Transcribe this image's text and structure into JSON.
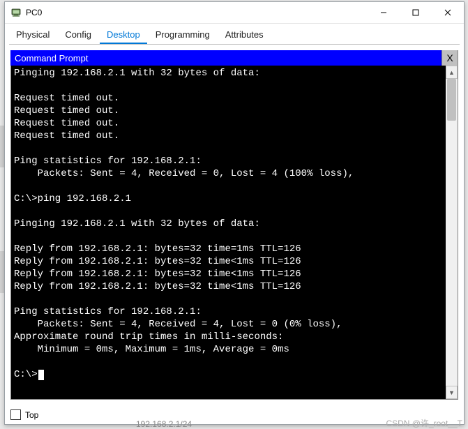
{
  "window": {
    "title": "PC0"
  },
  "tabs": [
    {
      "label": "Physical",
      "active": false
    },
    {
      "label": "Config",
      "active": false
    },
    {
      "label": "Desktop",
      "active": true
    },
    {
      "label": "Programming",
      "active": false
    },
    {
      "label": "Attributes",
      "active": false
    }
  ],
  "cmd": {
    "title": "Command Prompt",
    "close_label": "X"
  },
  "terminal_lines": [
    "Pinging 192.168.2.1 with 32 bytes of data:",
    "",
    "Request timed out.",
    "Request timed out.",
    "Request timed out.",
    "Request timed out.",
    "",
    "Ping statistics for 192.168.2.1:",
    "    Packets: Sent = 4, Received = 0, Lost = 4 (100% loss),",
    "",
    "C:\\>ping 192.168.2.1",
    "",
    "Pinging 192.168.2.1 with 32 bytes of data:",
    "",
    "Reply from 192.168.2.1: bytes=32 time=1ms TTL=126",
    "Reply from 192.168.2.1: bytes=32 time<1ms TTL=126",
    "Reply from 192.168.2.1: bytes=32 time<1ms TTL=126",
    "Reply from 192.168.2.1: bytes=32 time<1ms TTL=126",
    "",
    "Ping statistics for 192.168.2.1:",
    "    Packets: Sent = 4, Received = 4, Lost = 0 (0% loss),",
    "Approximate round trip times in milli-seconds:",
    "    Minimum = 0ms, Maximum = 1ms, Average = 0ms",
    "",
    "C:\\>"
  ],
  "bottom": {
    "top_label": "Top",
    "top_checked": false
  },
  "footer": {
    "watermark": "CSDN @许_root__T",
    "bg_ip": "192.168.2.1/24"
  }
}
